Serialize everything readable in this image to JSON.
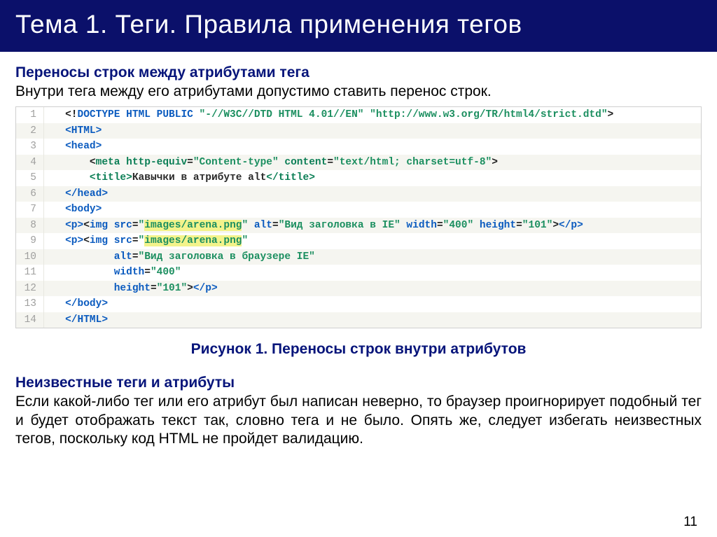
{
  "title": "Тема 1. Теги. Правила применения тегов",
  "section1": {
    "heading": "Переносы строк между атрибутами тега",
    "text": "Внутри тега между его атрибутами допустимо ставить перенос строк."
  },
  "code_lines": {
    "l1": "1",
    "l2": "2",
    "l3": "3",
    "l4": "4",
    "l5": "5",
    "l6": "6",
    "l7": "7",
    "l8": "8",
    "l9": "9",
    "l10": "10",
    "l11": "11",
    "l12": "12",
    "l13": "13",
    "l14": "14"
  },
  "code": {
    "doctype": {
      "open": "<!",
      "kw": "DOCTYPE HTML PUBLIC",
      "s1": " \"-//W3C//DTD HTML 4.01//EN\"",
      "s2": " \"http://www.w3.org/TR/html4/strict.dtd\"",
      "close": ">"
    },
    "html_open": "<HTML>",
    "head_open": "<head>",
    "meta": {
      "start": "<meta ",
      "a1": "http-equiv",
      "eq": "=",
      "v1": "\"Content-type\"",
      "a2": " content",
      "v2": "\"text/html; charset=utf-8\"",
      "end": ">"
    },
    "title": {
      "open": "<title>",
      "text": "Кавычки в атрибуте alt",
      "close": "</title>"
    },
    "head_close": "</head>",
    "body_open": "<body>",
    "line8": {
      "p_open": "<p>",
      "img_open": "<img ",
      "src_attr": "src",
      "eq": "=",
      "src_q1": "\"",
      "src_hl": "images/arena.png",
      "src_q2": "\"",
      "alt_attr": " alt",
      "alt_val": "\"Вид заголовка в IE\"",
      "w_attr": " width",
      "w_val": "\"400\"",
      "h_attr": " height",
      "h_val": "\"101\"",
      "img_close": ">",
      "p_close": "</p>"
    },
    "line9": {
      "p_open": "<p>",
      "img_open": "<img ",
      "src_attr": "src",
      "eq": "=",
      "src_q1": "\"",
      "src_hl": "images/arena.png",
      "src_q2": "\""
    },
    "line10": {
      "alt_attr": "alt",
      "eq": "=",
      "alt_val": "\"Вид заголовка в браузере IE\""
    },
    "line11": {
      "w_attr": "width",
      "eq": "=",
      "w_val": "\"400\""
    },
    "line12": {
      "h_attr": "height",
      "eq": "=",
      "h_val": "\"101\"",
      "img_close": ">",
      "p_close": "</p>"
    },
    "body_close": "</body>",
    "html_close": "</HTML>"
  },
  "figure_caption": "Рисунок 1. Переносы строк внутри атрибутов",
  "section2": {
    "heading": "Неизвестные теги и атрибуты",
    "text": "Если какой-либо тег или его атрибут был написан неверно, то браузер проигнорирует подобный тег и будет отображать текст так, словно тега и не было. Опять же, следует избегать неизвестных тегов, поскольку код HTML не пройдет валидацию."
  },
  "page_number": "11"
}
